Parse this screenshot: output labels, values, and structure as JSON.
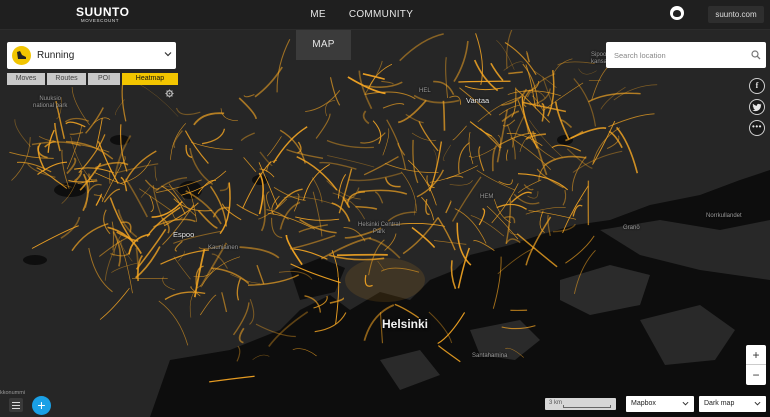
{
  "header": {
    "brand": "SUUNTO",
    "brand_sub": "MOVESCOUNT",
    "tabs": [
      {
        "id": "me",
        "label": "ME"
      },
      {
        "id": "map",
        "label": "MAP",
        "active": true
      },
      {
        "id": "community",
        "label": "COMMUNITY"
      }
    ],
    "site_link": "suunto.com"
  },
  "activity": {
    "selected": "Running",
    "icon": "running-shoe-icon",
    "icon_color": "#f2c500"
  },
  "modes": [
    {
      "id": "moves",
      "label": "Moves"
    },
    {
      "id": "routes",
      "label": "Routes"
    },
    {
      "id": "poi",
      "label": "POI"
    },
    {
      "id": "heatmap",
      "label": "Heatmap",
      "active": true
    }
  ],
  "search": {
    "placeholder": "Search location",
    "value": ""
  },
  "social": {
    "facebook": "f",
    "twitter_icon": "twitter-icon",
    "more": "•••"
  },
  "zoom": {
    "in": "+",
    "out": "−"
  },
  "bottom": {
    "add": "+",
    "scale_label": "3 km",
    "provider": "Mapbox",
    "style": "Dark map",
    "corner_text": "kkonummi"
  },
  "map": {
    "heat_color": "#f5a623",
    "places": [
      {
        "id": "nuuksio",
        "label": "Nuuksio",
        "label2": "national park"
      },
      {
        "id": "hel",
        "label": "HEL"
      },
      {
        "id": "vantaa",
        "label": "Vantaa"
      },
      {
        "id": "sipoo",
        "label": "Sipoo",
        "label2": "kansa"
      },
      {
        "id": "hem",
        "label": "HEM"
      },
      {
        "id": "central-park",
        "label": "Helsinki Central",
        "label2": "Park"
      },
      {
        "id": "espoo",
        "label": "Espoo"
      },
      {
        "id": "kauniainen",
        "label": "Kauniainen"
      },
      {
        "id": "helsinki",
        "label": "Helsinki"
      },
      {
        "id": "santahamina",
        "label": "Santahamina"
      },
      {
        "id": "grano",
        "label": "Granö"
      },
      {
        "id": "norrkullandet",
        "label": "Norrkullandet"
      }
    ]
  }
}
